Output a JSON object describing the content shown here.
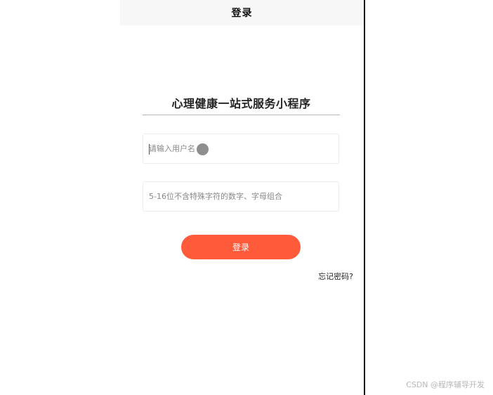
{
  "navbar": {
    "title": "登录"
  },
  "app": {
    "title": "心理健康一站式服务小程序"
  },
  "form": {
    "username_placeholder": "请输入用户名",
    "username_value": "",
    "password_placeholder": "5-16位不含特殊字符的数字、字母组合",
    "password_value": "",
    "submit_label": "登录",
    "forgot_label": "忘记密码?"
  },
  "watermark": "CSDN @程序辅导开发",
  "colors": {
    "accent": "#ff5b3a",
    "navbar_bg": "#f7f7f7",
    "divider": "#111111"
  }
}
